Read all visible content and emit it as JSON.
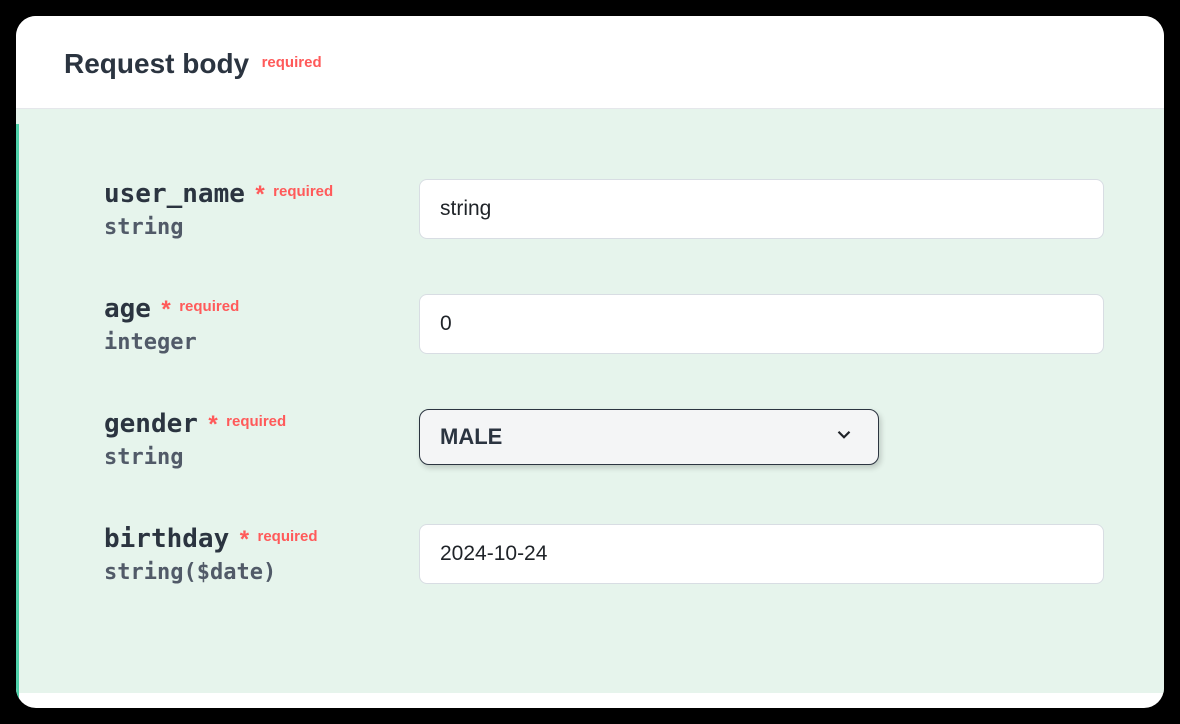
{
  "header": {
    "title": "Request body",
    "required_label": "required"
  },
  "fields": {
    "user_name": {
      "name": "user_name",
      "asterisk": "*",
      "required_label": "required",
      "type": "string",
      "value": "string"
    },
    "age": {
      "name": "age",
      "asterisk": "*",
      "required_label": "required",
      "type": "integer",
      "value": "0"
    },
    "gender": {
      "name": "gender",
      "asterisk": "*",
      "required_label": "required",
      "type": "string",
      "value": "MALE"
    },
    "birthday": {
      "name": "birthday",
      "asterisk": "*",
      "required_label": "required",
      "type": "string($date)",
      "value": "2024-10-24"
    }
  }
}
